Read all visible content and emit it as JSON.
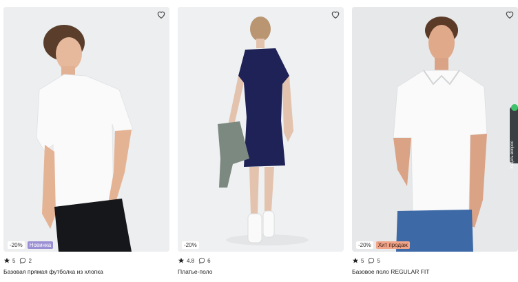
{
  "products": [
    {
      "discount": "-20%",
      "tag": "Новинка",
      "rating": "5",
      "reviews": "2",
      "title": "Базовая прямая футболка из хлопка"
    },
    {
      "discount": "-20%",
      "tag": "",
      "rating": "4.8",
      "reviews": "6",
      "title": "Платье-поло"
    },
    {
      "discount": "-20%",
      "tag": "Хит продаж",
      "rating": "5",
      "reviews": "5",
      "title": "Базовое поло REGULAR FIT"
    }
  ],
  "ask_question": "Задать вопрос",
  "icons": {
    "favorite": "heart-outline-icon",
    "rating": "star-icon",
    "reviews": "speech-bubble-icon"
  },
  "colors": {
    "badge_new": "#9a8fd3",
    "badge_hit": "#f3a58a",
    "ask_button": "#3a3f44",
    "ask_dot": "#3fc36a"
  }
}
